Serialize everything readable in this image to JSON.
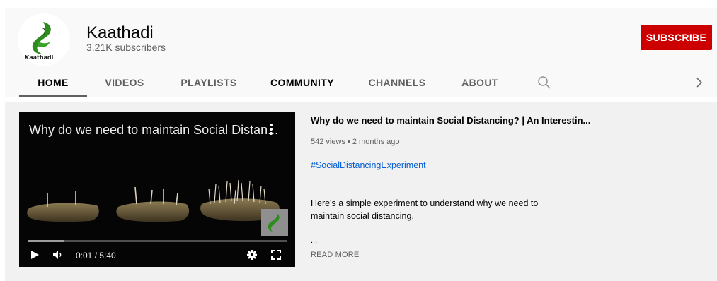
{
  "channel": {
    "name": "Kaathadi",
    "subscribers": "3.21K subscribers",
    "avatar_label": "Kaathadi",
    "subscribe_label": "SUBSCRIBE",
    "accent_color": "#cc0000"
  },
  "tabs": [
    {
      "label": "HOME",
      "active": true
    },
    {
      "label": "VIDEOS",
      "active": false
    },
    {
      "label": "PLAYLISTS",
      "active": false
    },
    {
      "label": "COMMUNITY",
      "active": false
    },
    {
      "label": "CHANNELS",
      "active": false
    },
    {
      "label": "ABOUT",
      "active": false
    }
  ],
  "tab_icons": {
    "search": "search-icon",
    "next": "chevron-right-icon"
  },
  "featured": {
    "player": {
      "title": "Why do we need to maintain Social Distan...",
      "time": "0:01 / 5:40",
      "progress_fraction": 0.14,
      "icons": [
        "play-icon",
        "volume-icon",
        "settings-icon",
        "fullscreen-icon",
        "more-vert-icon"
      ]
    },
    "title": "Why do we need to maintain Social Distancing? | An Interestin...",
    "meta": "542 views • 2 months ago",
    "hashtag": "#SocialDistancingExperiment",
    "description": "Here's a simple experiment to understand why we need to maintain social distancing.",
    "ellipsis": "...",
    "read_more": "READ MORE",
    "link_color": "#065fd4"
  }
}
